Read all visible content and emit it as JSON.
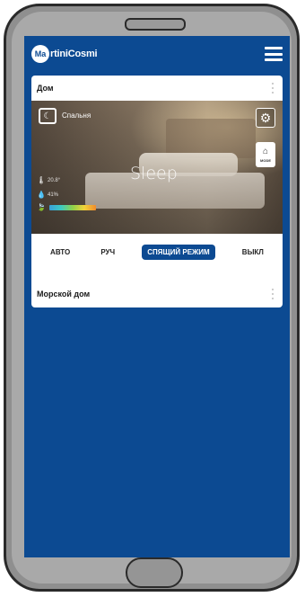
{
  "header": {
    "logo_badge": "Ma",
    "logo_text": "rtiniCosmi"
  },
  "cards": [
    {
      "title": "Дом",
      "room": {
        "name": "Спальня",
        "mode_label": "MODE",
        "sleep_label": "Sleep",
        "temperature": "20.8°",
        "humidity": "41%"
      },
      "mode_tabs": [
        "АВТО",
        "РУЧ",
        "СПЯЩИЙ РЕЖИМ",
        "ВЫКЛ"
      ],
      "active_mode": "СПЯЩИЙ РЕЖИМ"
    },
    {
      "title": "Морской дом"
    }
  ],
  "colors": {
    "brand_blue": "#0c4a92",
    "card_bg": "#ffffff",
    "frame_gray": "#a9a9a9"
  },
  "icons": {
    "menu": "hamburger-menu-icon",
    "kebab": "kebab-menu-icon",
    "room": "room-sleep-icon",
    "settings": "gear-icon",
    "mode": "house-mode-icon",
    "temperature": "thermometer-icon",
    "humidity": "water-drop-icon",
    "eco": "leaf-icon"
  }
}
